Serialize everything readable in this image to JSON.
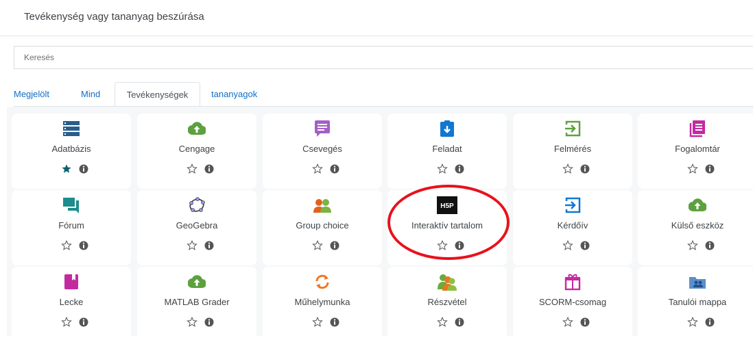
{
  "modal": {
    "title": "Tevékenység vagy tananyag beszúrása"
  },
  "search": {
    "placeholder": "Keresés"
  },
  "tabs": [
    {
      "label": "Megjelölt"
    },
    {
      "label": "Mind"
    },
    {
      "label": "Tevékenységek",
      "active": true
    },
    {
      "label": "tananyagok"
    }
  ],
  "items": [
    {
      "label": "Adatbázis",
      "icon": "database-icon",
      "starred": true
    },
    {
      "label": "Cengage",
      "icon": "lti-upload-icon",
      "starred": false
    },
    {
      "label": "Csevegés",
      "icon": "chat-icon",
      "starred": false
    },
    {
      "label": "Feladat",
      "icon": "assignment-icon",
      "starred": false
    },
    {
      "label": "Felmérés",
      "icon": "survey-icon",
      "starred": false
    },
    {
      "label": "Fogalomtár",
      "icon": "glossary-icon",
      "starred": false
    },
    {
      "label": "Fórum",
      "icon": "forum-icon",
      "starred": false
    },
    {
      "label": "GeoGebra",
      "icon": "geogebra-icon",
      "starred": false
    },
    {
      "label": "Group choice",
      "icon": "group-choice-icon",
      "starred": false
    },
    {
      "label": "Interaktív tartalom",
      "icon": "h5p-icon",
      "starred": false
    },
    {
      "label": "Kérdőív",
      "icon": "questionnaire-icon",
      "starred": false
    },
    {
      "label": "Külső eszköz",
      "icon": "external-tool-icon",
      "starred": false
    },
    {
      "label": "Lecke",
      "icon": "lesson-icon",
      "starred": false
    },
    {
      "label": "MATLAB Grader",
      "icon": "lti-upload-icon",
      "starred": false
    },
    {
      "label": "Műhelymunka",
      "icon": "workshop-icon",
      "starred": false
    },
    {
      "label": "Részvétel",
      "icon": "attendance-icon",
      "starred": false
    },
    {
      "label": "SCORM-csomag",
      "icon": "scorm-icon",
      "starred": false
    },
    {
      "label": "Tanulói mappa",
      "icon": "student-folder-icon",
      "starred": false
    }
  ],
  "highlighted_item": "Interaktív tartalom",
  "colors": {
    "link": "#0f6fc5",
    "star_active": "#0a6170",
    "highlight_ring": "#e8111b",
    "database": "#2a5d8c",
    "green": "#5da13f",
    "purple": "#a45fc7",
    "blue": "#1177d1",
    "magenta": "#c42aa0",
    "teal": "#1e8c8c",
    "orange": "#f07820"
  }
}
